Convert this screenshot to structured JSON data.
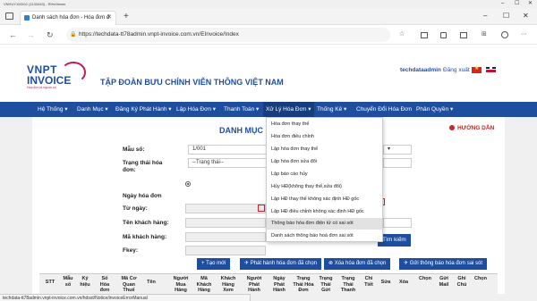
{
  "window": {
    "title": "VNHUY100011 (1133443) - RHsViewer",
    "min_icon": "–",
    "max_icon": "☐",
    "close_icon": "✕"
  },
  "browser": {
    "tab_title": "Danh sách hóa đơn - Hóa đơn đ",
    "tab_close": "✕",
    "new_tab": "+",
    "url": "https://techdata-tt78admin.vnpt-invoice.com.vn/EInvoice/Index",
    "back": "←",
    "forward": "→",
    "reload": "↻",
    "lock": "🔒",
    "toolbar_icons": [
      "☆",
      "⊞",
      "⋯"
    ]
  },
  "header": {
    "logo_line1": "VNPT",
    "logo_line2": "INVOICE",
    "logo_tag": "Hóa đơn là nguồn số",
    "company_name": "TẬP ĐOÀN BƯU CHÍNH VIỄN THÔNG VIỆT NAM",
    "user": "techdataadmin",
    "logout": "Đăng xuất"
  },
  "menu": [
    {
      "label": "Hệ Thống ▾"
    },
    {
      "label": "Danh Mục ▾"
    },
    {
      "label": "Đăng Ký Phát Hành ▾"
    },
    {
      "label": "Lập Hóa Đơn ▾"
    },
    {
      "label": "Thanh Toán ▾"
    },
    {
      "label": "Xử Lý Hóa Đơn ▾"
    },
    {
      "label": "Thống Kê ▾"
    },
    {
      "label": "Chuyển Đổi Hóa Đơn"
    },
    {
      "label": "Phân Quyền ▾"
    }
  ],
  "page": {
    "heading": "DANH MỤC HÓA",
    "help": "HƯỚNG DẪN"
  },
  "form": {
    "mau_so_label": "Mẫu số:",
    "mau_so_value": "1/001",
    "trang_thai_label": "Trạng thái hóa đơn:",
    "trang_thai_value": "--Trạng thái--",
    "ngay_hoa_don_label": "Ngày hóa đơn",
    "tu_ngay_label": "Từ ngày:",
    "ten_khach_hang_label": "Tên khách hàng:",
    "ma_khach_hang_label": "Mã khách hàng:",
    "fkey_label": "Fkey:",
    "search_button": "Tìm kiếm"
  },
  "dropdown": [
    "Hóa đơn thay thế",
    "Hóa đơn điều chỉnh",
    "Lập hóa đơn thay thế",
    "Lập hóa đơn sửa đổi",
    "Lập báo cáo hủy",
    "Hủy HĐ(không thay thế,sửa đổi)",
    "Lập HĐ thay thế không xác định HĐ gốc",
    "Lập HĐ điều chỉnh không xác định HĐ gốc",
    "Thông báo hóa đơn điện tử có sai sót",
    "Danh sách thông báo hoá đơn sai sót"
  ],
  "actions": [
    "+ Tạo mới",
    "✈ Phát hành hóa đơn đã chọn",
    "⊗ Xóa hóa đơn đã chọn",
    "✈ Gửi thông báo hóa đơn sai sót"
  ],
  "table_headers": [
    "STT",
    "Mẫu số",
    "Ký hiệu",
    "Số Hóa đơn",
    "Mã Cơ Quan Thuế",
    "Tên",
    "Người Mua Hàng",
    "Mã Khách Hàng",
    "Khách Hàng Xem",
    "Người Phát Hành",
    "Ngày Phát Hành",
    "Trạng Thái Hóa Đơn",
    "Trạng Thái Gửi CQT",
    "Trạng Thái Thanh Toán",
    "Chi Tiết",
    "Sửa",
    "Xóa",
    "Chọn",
    "Gửi Mail",
    "Ghi Chú",
    "Chọn"
  ],
  "status_bar": "techdata-tt78admin.vnpt-invoice.com.vn/hdsst/Notice/invoiceErrorManual",
  "colors": {
    "brand_blue": "#1f4e9e",
    "brand_magenta": "#c2185b",
    "help_red": "#c62828"
  }
}
